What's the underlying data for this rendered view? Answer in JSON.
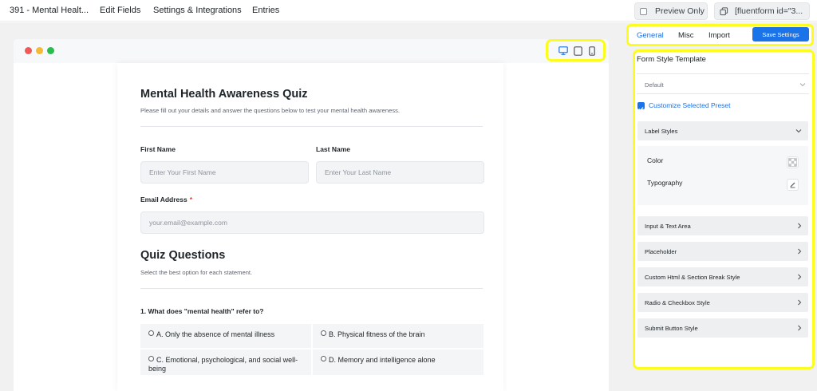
{
  "topbar": {
    "form_name": "391 - Mental Healt...",
    "nav": [
      "Edit Fields",
      "Settings & Integrations",
      "Entries"
    ],
    "preview_label": "Preview Only",
    "shortcode": "[fluentform id=\"3..."
  },
  "preview": {
    "window_dot_colors": [
      "#ee5a57",
      "#f4b935",
      "#26bf4a"
    ],
    "device_icons": [
      "desktop-icon",
      "tablet-icon",
      "mobile-icon"
    ]
  },
  "form": {
    "title": "Mental Health Awareness Quiz",
    "subtitle": "Please fill out your details and answer the questions below to test your mental health awareness.",
    "first_name_label": "First Name",
    "first_name_placeholder": "Enter Your First Name",
    "last_name_label": "Last Name",
    "last_name_placeholder": "Enter Your Last Name",
    "email_label": "Email Address",
    "email_required_mark": "*",
    "email_placeholder": "your.email@example.com",
    "section_title": "Quiz Questions",
    "section_subtitle": "Select the best option for each statement.",
    "question": "1. What does \"mental health\" refer to?",
    "options": [
      "A. Only the absence of mental illness",
      "B. Physical fitness of the brain",
      "C. Emotional, psychological, and social well-being",
      "D. Memory and intelligence alone"
    ]
  },
  "panel": {
    "tabs": [
      "General",
      "Misc",
      "Import"
    ],
    "active_tab": "General",
    "save_label": "Save Settings",
    "template_title": "Form Style Template",
    "template_value": "Default",
    "customize_label": "Customize Selected Preset",
    "label_styles": "Label Styles",
    "color_label": "Color",
    "typography_label": "Typography",
    "sections": [
      "Input & Text Area",
      "Placeholder",
      "Custom Html & Section Break Style",
      "Radio & Checkbox Style",
      "Submit Button Style"
    ]
  },
  "colors": {
    "accent": "#1a73e8",
    "highlight": "#fdfc1f",
    "required": "#e3362c"
  }
}
